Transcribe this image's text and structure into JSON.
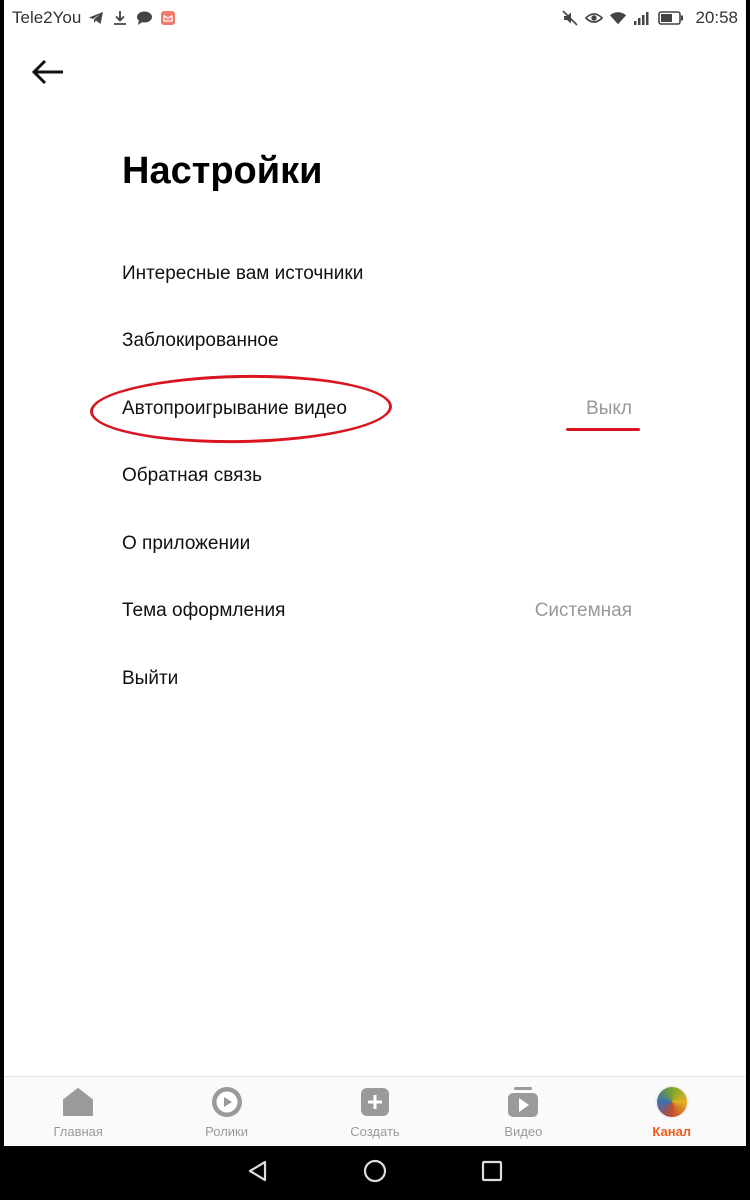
{
  "status_bar": {
    "carrier": "Tele2You",
    "time": "20:58",
    "icons_left": [
      "telegram-icon",
      "download-icon",
      "chat-bubble-icon",
      "mail-notification-icon"
    ],
    "icons_right": [
      "mute-icon",
      "eye-icon",
      "wifi-icon",
      "signal-icon",
      "battery-icon"
    ]
  },
  "header": {
    "back_icon": "arrow-left-icon",
    "title": "Настройки"
  },
  "settings": [
    {
      "label": "Интересные вам источники",
      "value": ""
    },
    {
      "label": "Заблокированное",
      "value": ""
    },
    {
      "label": "Автопроигрывание видео",
      "value": "Выкл"
    },
    {
      "label": "Обратная связь",
      "value": ""
    },
    {
      "label": "О приложении",
      "value": ""
    },
    {
      "label": "Тема оформления",
      "value": "Системная"
    },
    {
      "label": "Выйти",
      "value": ""
    }
  ],
  "tabs": [
    {
      "label": "Главная",
      "icon": "home-icon",
      "active": false
    },
    {
      "label": "Ролики",
      "icon": "shorts-play-icon",
      "active": false
    },
    {
      "label": "Создать",
      "icon": "plus-square-icon",
      "active": false
    },
    {
      "label": "Видео",
      "icon": "video-library-icon",
      "active": false
    },
    {
      "label": "Канал",
      "icon": "channel-avatar",
      "active": true
    }
  ],
  "colors": {
    "accent": "#f05a1a",
    "annotation": "#d9161f",
    "muted_text": "#999999"
  }
}
